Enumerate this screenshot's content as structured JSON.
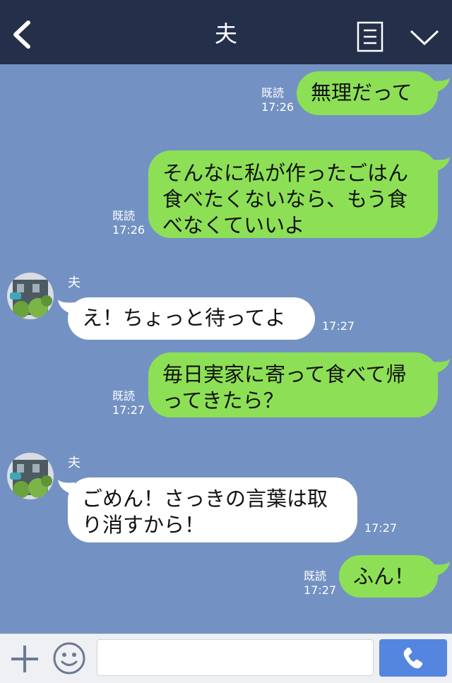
{
  "header": {
    "title": "夫",
    "back_icon": "chevron-left-icon",
    "menu_icon": "menu-icon",
    "collapse_icon": "chevron-down-icon"
  },
  "contact": {
    "name": "夫"
  },
  "messages": [
    {
      "side": "sent",
      "text": "無理だって",
      "read": "既読",
      "time": "17:26"
    },
    {
      "side": "sent",
      "text": "そんなに私が作ったごはん\n食べたくないなら、もう食\nべなくていいよ",
      "read": "既読",
      "time": "17:26"
    },
    {
      "side": "received",
      "sender": "夫",
      "text": "え！ちょっと待ってよ",
      "time": "17:27"
    },
    {
      "side": "sent",
      "text": "毎日実家に寄って食べて帰\nってきたら？",
      "read": "既読",
      "time": "17:27"
    },
    {
      "side": "received",
      "sender": "夫",
      "text": "ごめん！さっきの言葉は取\nり消すから！",
      "time": "17:27"
    },
    {
      "side": "sent",
      "text": "ふん！",
      "read": "既読",
      "time": "17:27"
    }
  ],
  "input_bar": {
    "plus_icon": "plus-icon",
    "emoji_icon": "emoji-icon",
    "message_value": "",
    "call_icon": "phone-icon"
  },
  "colors": {
    "header_bg": "#242f4a",
    "chat_bg": "#7392c3",
    "sent_bubble": "#8de055",
    "received_bubble": "#ffffff",
    "call_button": "#5486e0"
  }
}
